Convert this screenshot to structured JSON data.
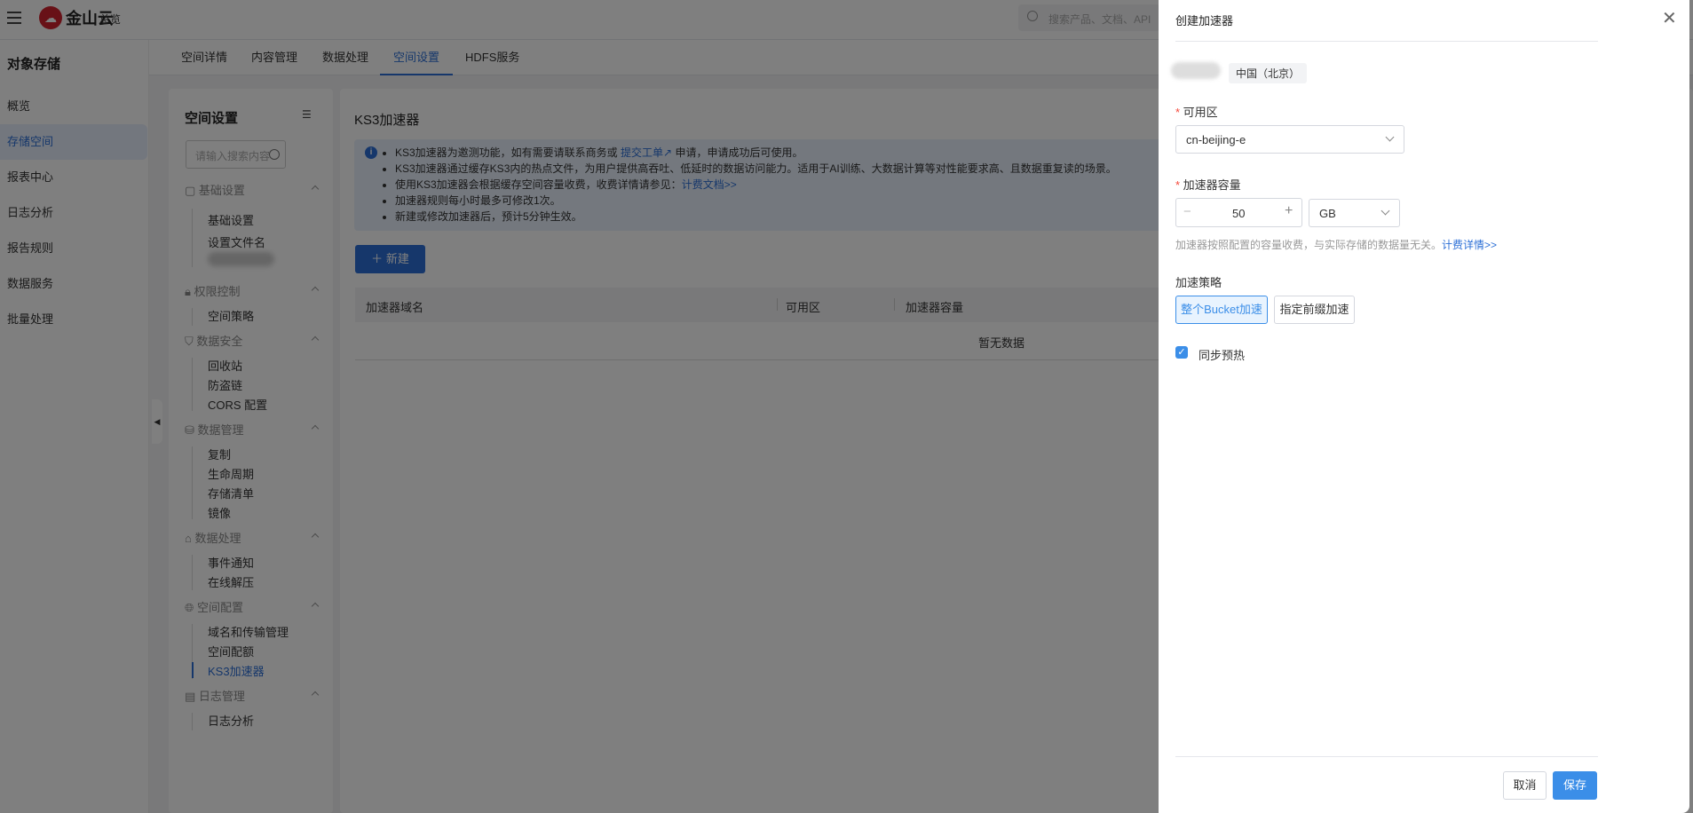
{
  "topbar": {
    "overview": "总览",
    "search_placeholder": "搜索产品、文档、API"
  },
  "leftnav": {
    "title": "对象存储",
    "items": [
      {
        "label": "概览"
      },
      {
        "label": "存储空间"
      },
      {
        "label": "报表中心"
      },
      {
        "label": "日志分析"
      },
      {
        "label": "报告规则"
      },
      {
        "label": "数据服务"
      },
      {
        "label": "批量处理"
      }
    ]
  },
  "tabs": [
    {
      "label": "空间详情"
    },
    {
      "label": "内容管理"
    },
    {
      "label": "数据处理"
    },
    {
      "label": "空间设置"
    },
    {
      "label": "HDFS服务"
    }
  ],
  "settings": {
    "title": "空间设置",
    "search_placeholder": "请输入搜索内容",
    "groups": [
      {
        "label": "基础设置",
        "children": [
          "基础设置",
          "设置文件名"
        ]
      },
      {
        "label": "权限控制",
        "children": [
          "空间策略"
        ]
      },
      {
        "label": "数据安全",
        "children": [
          "回收站",
          "防盗链",
          "CORS 配置"
        ]
      },
      {
        "label": "数据管理",
        "children": [
          "复制",
          "生命周期",
          "存储清单",
          "镜像"
        ]
      },
      {
        "label": "数据处理",
        "children": [
          "事件通知",
          "在线解压"
        ]
      },
      {
        "label": "空间配置",
        "children": [
          "域名和传输管理",
          "空间配额",
          "KS3加速器"
        ]
      },
      {
        "label": "日志管理",
        "children": [
          "日志分析"
        ]
      }
    ]
  },
  "main": {
    "title": "KS3加速器",
    "info": {
      "line1_pre": "KS3加速器为邀测功能，如有需要请联系商务或",
      "line1_link": "提交工单",
      "line1_post": "申请，申请成功后可使用。",
      "line2": "KS3加速器通过缓存KS3内的热点文件，为用户提供高吞吐、低延时的数据访问能力。适用于AI训练、大数据计算等对性能要求高、且数据重复读的场景。",
      "line3_pre": "使用KS3加速器会根据缓存空间容量收费，收费详情请参见：",
      "line3_link": "计费文档>>",
      "line4": "加速器规则每小时最多可修改1次。",
      "line5": "新建或修改加速器后，预计5分钟生效。"
    },
    "new_button": "新建",
    "table": {
      "columns": [
        "加速器域名",
        "可用区",
        "加速器容量"
      ],
      "empty": "暂无数据"
    }
  },
  "drawer": {
    "title": "创建加速器",
    "region_tag": "中国（北京）",
    "zone_label": "可用区",
    "zone_value": "cn-beijing-e",
    "capacity_label": "加速器容量",
    "capacity_value": "50",
    "unit_value": "GB",
    "hint": "加速器按照配置的容量收费，与实际存储的数据量无关。",
    "hint_link": "计费详情>>",
    "strategy_label": "加速策略",
    "strategy_options": [
      "整个Bucket加速",
      "指定前缀加速"
    ],
    "preheat_label": "同步预热",
    "preheat_checked": true,
    "cancel": "取消",
    "save": "保存"
  },
  "colors": {
    "accent": "#2c6fd6",
    "primary_button": "#3b8ee8"
  }
}
